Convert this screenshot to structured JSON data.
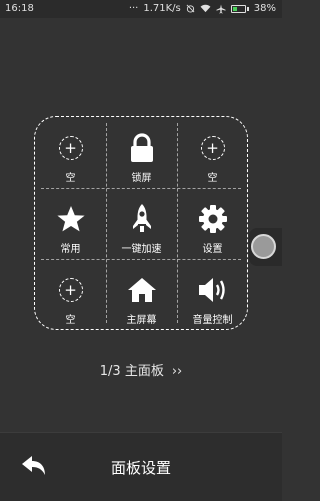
{
  "status_bar": {
    "time": "16:18",
    "dots": "···",
    "network_speed": "1.71K/s",
    "battery_percent": "38%",
    "battery_level": 0.38,
    "battery_color": "#4ad15a"
  },
  "panel": {
    "items": [
      {
        "label": "空",
        "icon": "add-circle-icon"
      },
      {
        "label": "锁屏",
        "icon": "lock-icon"
      },
      {
        "label": "空",
        "icon": "add-circle-icon"
      },
      {
        "label": "常用",
        "icon": "star-icon"
      },
      {
        "label": "一键加速",
        "icon": "rocket-icon"
      },
      {
        "label": "设置",
        "icon": "gear-icon"
      },
      {
        "label": "空",
        "icon": "add-circle-icon"
      },
      {
        "label": "主屏幕",
        "icon": "home-icon"
      },
      {
        "label": "音量控制",
        "icon": "volume-icon"
      }
    ],
    "plus": "+"
  },
  "pager": {
    "label": "1/3 主面板",
    "arrow": "››"
  },
  "bottom_bar": {
    "title": "面板设置",
    "back_icon": "back-icon"
  }
}
